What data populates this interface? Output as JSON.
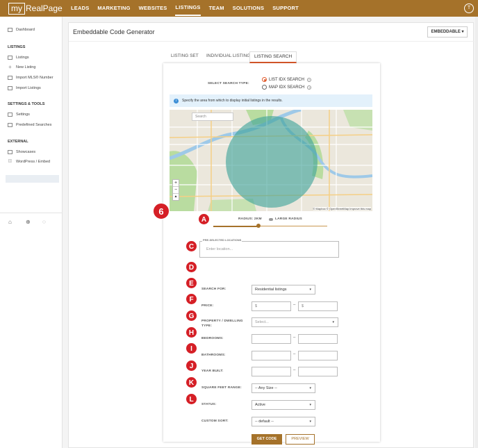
{
  "brand": {
    "logo_box": "my",
    "logo_text": "RealPage"
  },
  "nav": {
    "items": [
      "LEADS",
      "MARKETING",
      "WEBSITES",
      "LISTINGS",
      "TEAM",
      "SOLUTIONS",
      "SUPPORT"
    ],
    "active": "LISTINGS",
    "avatar": "T"
  },
  "sidebar": {
    "dashboard": "Dashboard",
    "sections": [
      {
        "title": "LISTINGS",
        "items": [
          "Listings",
          "New Listing",
          "Import MLS® Number",
          "Import Listings"
        ]
      },
      {
        "title": "SETTINGS & TOOLS",
        "items": [
          "Settings",
          "Predefined Searches"
        ]
      },
      {
        "title": "EXTERNAL",
        "items": [
          "Showcases",
          "WordPress / Embed"
        ]
      }
    ],
    "active_item": "WordPress / Embed"
  },
  "page": {
    "title": "Embeddable Code Generator",
    "dropdown": "EMBEDDABLE"
  },
  "tabs": [
    "LISTING SET",
    "INDIVIDUAL LISTING",
    "LISTING SEARCH"
  ],
  "active_tab": "LISTING SEARCH",
  "search_type": {
    "label": "SELECT SEARCH TYPE:",
    "options": [
      "LIST IDX SEARCH",
      "MAP IDX SEARCH"
    ],
    "selected": "LIST IDX SEARCH"
  },
  "info_text": "Specify the area from which to display initial listings in the results.",
  "map": {
    "search_placeholder": "Search",
    "attribution": "© Mapbox © OpenStreetMap  Improve this map",
    "zoom_in": "+",
    "zoom_out": "−"
  },
  "radius": {
    "label": "RADIUS: 2KM",
    "large_label": "LARGE RADIUS"
  },
  "steps": [
    "6",
    "A",
    "C",
    "D",
    "E",
    "F",
    "G",
    "H",
    "I",
    "J",
    "K",
    "L"
  ],
  "form": {
    "preselected_label": "PRE-SELECTED LOCATIONS",
    "location_placeholder": "Enter location...",
    "search_for": {
      "label": "SEARCH FOR:",
      "value": "Residential listings"
    },
    "price": {
      "label": "PRICE:",
      "min_prefix": "$",
      "max_prefix": "$"
    },
    "property_type": {
      "label": "PROPERTY / DWELLING TYPE:",
      "placeholder": "Select..."
    },
    "bedrooms": {
      "label": "BEDROOMS:"
    },
    "bathrooms": {
      "label": "BATHROOMS:"
    },
    "year_built": {
      "label": "YEAR BUILT:"
    },
    "sqft": {
      "label": "SQUARE FEET RANGE:",
      "value": "-- Any Size --"
    },
    "status": {
      "label": "STATUS:",
      "value": "Active"
    },
    "custom_sort": {
      "label": "CUSTOM SORT:",
      "value": "-- default --"
    },
    "range_sep": "–"
  },
  "buttons": {
    "get_code": "GET CODE",
    "preview": "PREVIEW"
  },
  "colors": {
    "brand": "#a5722a",
    "accent": "#e05a2b",
    "step": "#d51f26",
    "map_circle": "#3fa39a"
  }
}
